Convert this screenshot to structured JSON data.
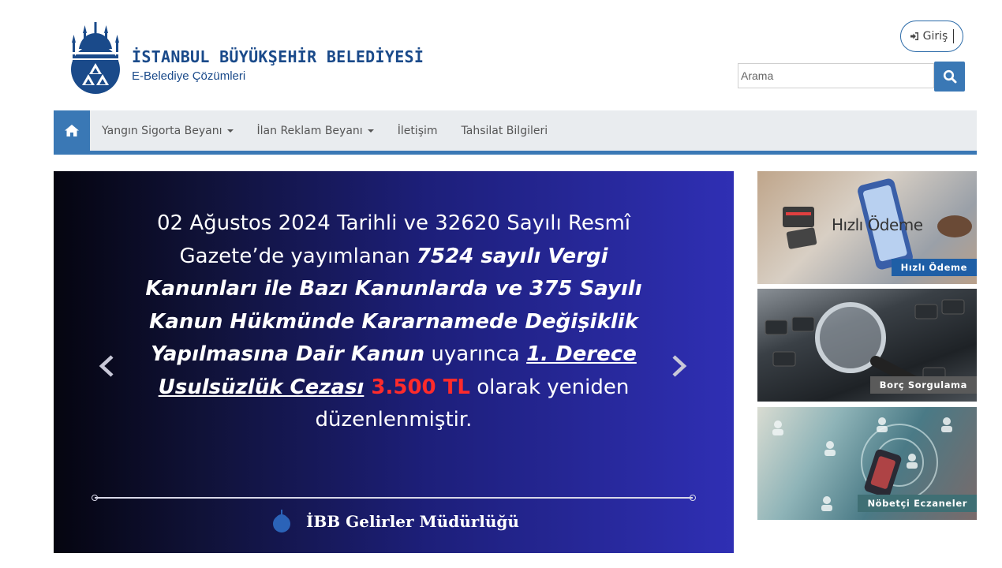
{
  "header": {
    "brand_title": "İSTANBUL BÜYÜKŞEHİR BELEDİYESİ",
    "brand_subtitle": "E-Belediye Çözümleri",
    "login_label": "Giriş",
    "search_placeholder": "Arama"
  },
  "nav": {
    "items": [
      {
        "label": "Yangın Sigorta Beyanı",
        "dropdown": true
      },
      {
        "label": "İlan Reklam Beyanı",
        "dropdown": true
      },
      {
        "label": "İletişim",
        "dropdown": false
      },
      {
        "label": "Tahsilat Bilgileri",
        "dropdown": false
      }
    ]
  },
  "carousel": {
    "line1": "02 Ağustos 2024 Tarihli ve 32620 Sayılı Resmî",
    "line2a": "Gazete’de  yayımlanan ",
    "line2b": "7524 sayılı Vergi",
    "line3": "Kanunları ile Bazı Kanunlarda ve 375 Sayılı",
    "line4": "Kanun Hükmünde Kararnamede Değişiklik",
    "line5a": "Yapılmasına Dair Kanun",
    "line5b": " uyarınca ",
    "line5c": "1. Derece",
    "line6a": "Usulsüzlük Cezası",
    "line6b": " 3.500 TL",
    "line6c": " olarak yeniden",
    "line7": "düzenlenmiştir.",
    "footer": "İBB Gelirler Müdürlüğü"
  },
  "cards": [
    {
      "label": "Hızlı Ödeme",
      "overlay_text": "Hızlı Ödeme",
      "label_color": "#1f5fa6"
    },
    {
      "label": "Borç Sorgulama",
      "label_color": "#5a5a5a"
    },
    {
      "label": "Nöbetçi Eczaneler",
      "label_color": "#3f6f74"
    }
  ],
  "colors": {
    "brand_blue": "#1a4a8a",
    "accent": "#3a78b5"
  }
}
